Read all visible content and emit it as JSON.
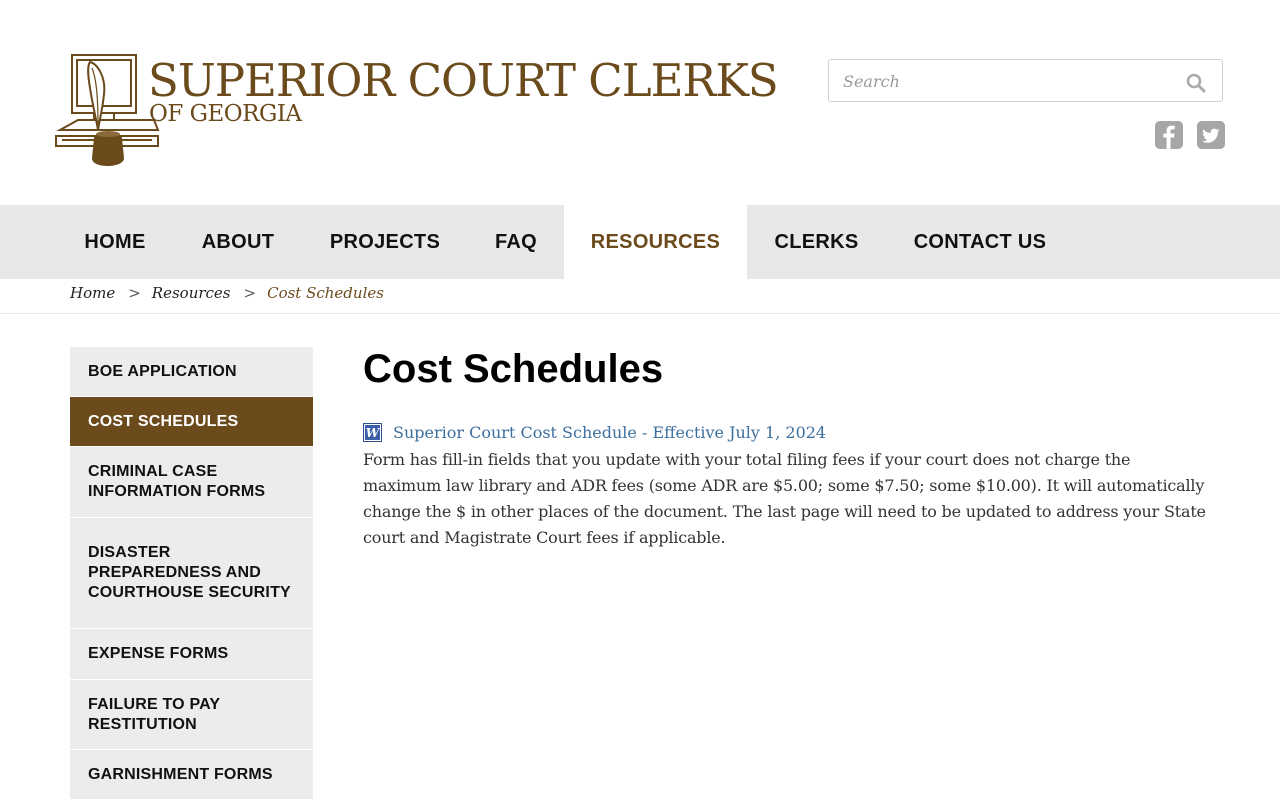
{
  "header": {
    "logo_title": "SUPERIOR COURT CLERKS",
    "logo_subtitle": "OF GEORGIA",
    "search_placeholder": "Search",
    "social": [
      {
        "icon": "facebook-icon",
        "glyph": "f"
      },
      {
        "icon": "twitter-icon",
        "glyph": "t"
      }
    ]
  },
  "nav": {
    "items": [
      "HOME",
      "ABOUT",
      "PROJECTS",
      "FAQ",
      "RESOURCES",
      "CLERKS",
      "CONTACT US"
    ],
    "active": "RESOURCES"
  },
  "breadcrumb": {
    "items": [
      "Home",
      "Resources",
      "Cost Schedules"
    ],
    "separator": ">"
  },
  "sidebar": {
    "items": [
      "BOE APPLICATION",
      "COST SCHEDULES",
      "CRIMINAL CASE INFORMATION FORMS",
      "DISASTER PREPAREDNESS AND COURTHOUSE SECURITY",
      "EXPENSE FORMS",
      "FAILURE TO PAY RESTITUTION",
      "GARNISHMENT FORMS"
    ],
    "active": "COST SCHEDULES"
  },
  "main": {
    "title": "Cost Schedules",
    "document_link": "Superior Court Cost Schedule - Effective July 1, 2024",
    "document_icon": "word-document-icon",
    "description": "Form has fill-in fields that you update with your total filing fees if your court does not charge the maximum law library and ADR fees (some ADR are $5.00; some $7.50; some $10.00). It will automatically change the $ in other places of the document. The last page will need to be updated to address your State court and Magistrate Court fees if applicable."
  },
  "colors": {
    "brand_brown": "#6b4a1c",
    "nav_bg": "#e8e8e8",
    "link_blue": "#3d6f9e"
  }
}
